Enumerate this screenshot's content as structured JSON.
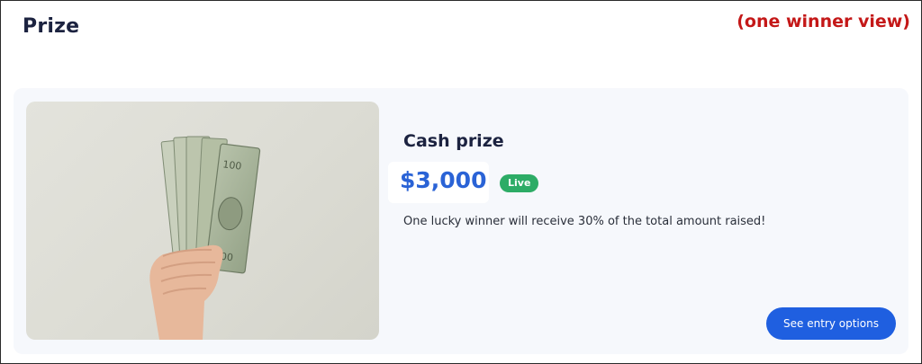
{
  "page": {
    "title": "Prize",
    "annotation": "(one winner view)"
  },
  "prize_card": {
    "image": {
      "subject": "hand-holding-cash-icon",
      "colors": {
        "background": "#dedfd8",
        "bills": "#a7b49a",
        "skin": "#e7b89b"
      }
    },
    "title": "Cash prize",
    "amount": "$3,000",
    "status": "Live",
    "description": "One lucky winner will receive 30% of the total amount raised!",
    "button_label": "See entry options"
  },
  "colors": {
    "accent": "#1f5fe0",
    "amount": "#2a63d6",
    "live_badge": "#2dac66",
    "annotation": "#c41818",
    "heading": "#1c2340"
  }
}
